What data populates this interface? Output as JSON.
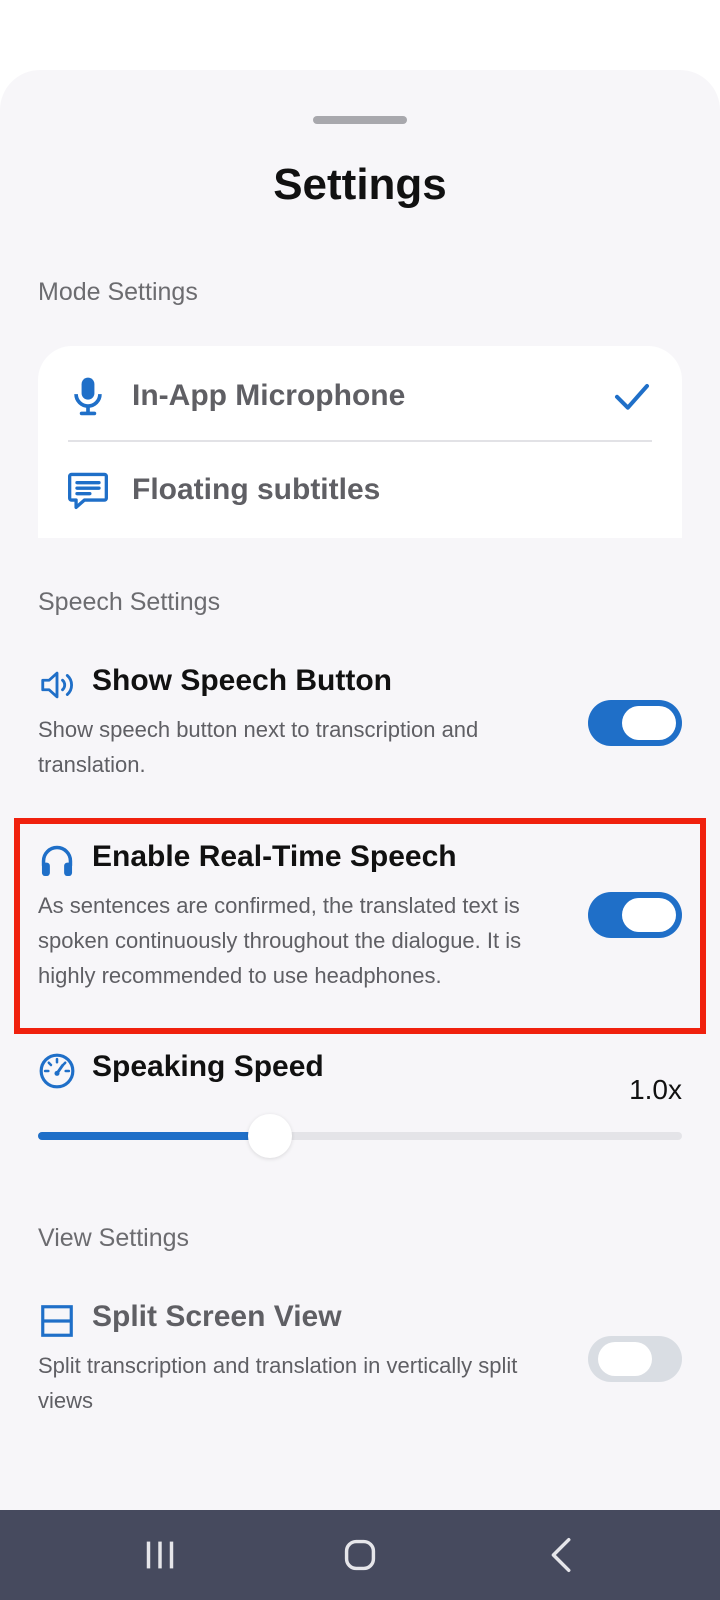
{
  "sheet": {
    "title": "Settings"
  },
  "mode_settings": {
    "label": "Mode Settings",
    "items": [
      {
        "label": "In-App Microphone",
        "icon": "microphone-icon",
        "selected": true
      },
      {
        "label": "Floating subtitles",
        "icon": "subtitles-icon",
        "selected": false
      }
    ]
  },
  "speech_settings": {
    "label": "Speech Settings",
    "show_speech_button": {
      "title": "Show Speech Button",
      "description": "Show speech button next to transcription and translation.",
      "icon": "speaker-icon",
      "enabled": true
    },
    "real_time_speech": {
      "title": "Enable Real-Time Speech",
      "description": "As sentences are confirmed, the translated text is spoken continuously throughout the dialogue. It is highly recommended to use headphones.",
      "icon": "headphones-icon",
      "enabled": true
    },
    "speaking_speed": {
      "title": "Speaking Speed",
      "value_label": "1.0x",
      "icon": "speedometer-icon",
      "level_fraction": 0.36
    }
  },
  "view_settings": {
    "label": "View Settings",
    "split_screen": {
      "title": "Split Screen View",
      "description": "Split transcription and translation in vertically split views",
      "icon": "split-view-icon",
      "enabled": false
    }
  },
  "colors": {
    "accent": "#1f6fc8",
    "highlight_border": "#f0210e",
    "sheet_background": "#f7f6f9",
    "navbar": "#464a5e"
  },
  "navbar": {
    "icons": [
      "recent-apps-icon",
      "home-icon",
      "back-icon"
    ]
  }
}
